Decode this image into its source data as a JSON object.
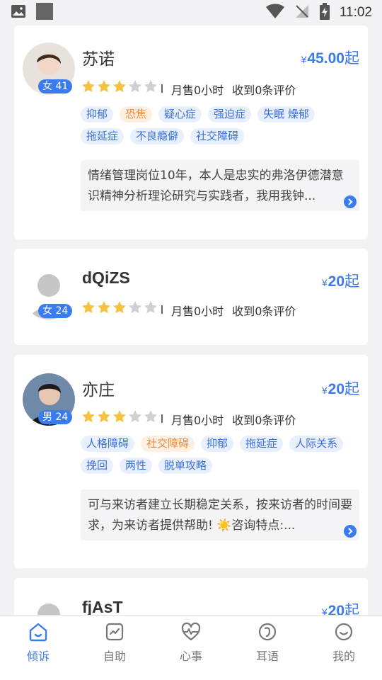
{
  "status_bar": {
    "time": "11:02"
  },
  "counselors": [
    {
      "name": "苏诺",
      "gender_age": "女 41",
      "price_symbol": "¥",
      "price": "45.00",
      "price_suffix": "起",
      "rating": 3,
      "monthly_sales": "月售0小时",
      "reviews": "收到0条评价",
      "tags": [
        "抑郁",
        "恐焦",
        "疑心症",
        "强迫症",
        "失眠 燥郁",
        "拖延症",
        "不良瘾僻",
        "社交障碍"
      ],
      "intro": "情绪管理岗位10年，本人是忠实的弗洛伊德潜意识精神分析理论研究与实践者，我用我钟..."
    },
    {
      "name": "dQiZS",
      "gender_age": "女 24",
      "price_symbol": "¥",
      "price": "20",
      "price_suffix": "起",
      "rating": 3,
      "monthly_sales": "月售0小时",
      "reviews": "收到0条评价"
    },
    {
      "name": "亦庄",
      "gender_age": "男 24",
      "price_symbol": "¥",
      "price": "20",
      "price_suffix": "起",
      "rating": 3,
      "monthly_sales": "月售0小时",
      "reviews": "收到0条评价",
      "tags": [
        "人格障碍",
        "社交障碍",
        "抑郁",
        "拖延症",
        "人际关系",
        "挽回",
        "两性",
        "脱单攻略"
      ],
      "intro": "可与来访者建立长期稳定关系，按来访者的时间要求，为来访者提供帮助! ☀️咨询特点:..."
    },
    {
      "name": "fjAsT",
      "price_symbol": "¥",
      "price": "20",
      "price_suffix": "起"
    }
  ],
  "nav": {
    "items": [
      {
        "label": "倾诉",
        "icon": "home-icon"
      },
      {
        "label": "自助",
        "icon": "chart-icon"
      },
      {
        "label": "心事",
        "icon": "heartbeat-icon"
      },
      {
        "label": "耳语",
        "icon": "ear-icon"
      },
      {
        "label": "我的",
        "icon": "smile-icon"
      }
    ],
    "active": "倾诉"
  },
  "colors": {
    "accent": "#3a7bf0",
    "orange_tag": "#f08a3c",
    "star_gold": "#f5c242",
    "star_gray": "#d0d0d0"
  }
}
